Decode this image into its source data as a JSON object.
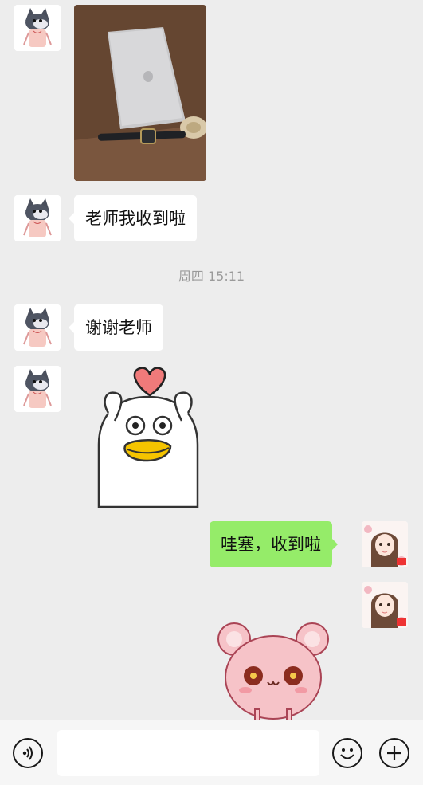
{
  "messages": {
    "m2_text": "老师我收到啦",
    "m3_text": "谢谢老师",
    "m5_text": "哇塞，收到啦"
  },
  "timestamp": "周四 15:11",
  "icons": {
    "voice": "voice-icon",
    "emoji": "emoji-icon",
    "plus": "plus-icon"
  },
  "colors": {
    "chat_background": "#ededed",
    "outgoing_bubble": "#95ec69",
    "incoming_bubble": "#ffffff"
  }
}
